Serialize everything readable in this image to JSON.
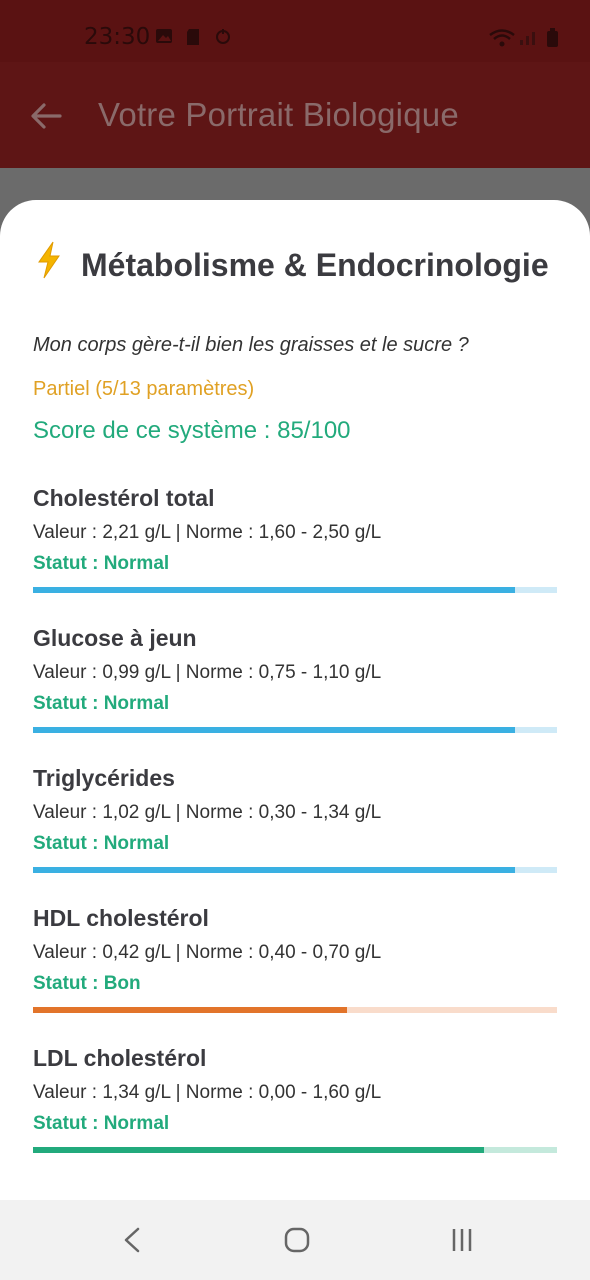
{
  "status_bar": {
    "time": "23:30"
  },
  "app_bar": {
    "title": "Votre Portrait Biologique"
  },
  "section": {
    "title": "Métabolisme & Endocrinologie",
    "question": "Mon corps gère-t-il bien les graisses et le sucre ?",
    "partial": "Partiel (5/13 paramètres)",
    "score": "Score de ce système : 85/100"
  },
  "params": [
    {
      "name": "Cholestérol total",
      "value": "Valeur : 2,21 g/L | Norme : 1,60 - 2,50 g/L",
      "status": "Statut : Normal",
      "fill": 0.92,
      "color": "#3ab0e2",
      "track": "#cfeaf7"
    },
    {
      "name": "Glucose à jeun",
      "value": "Valeur : 0,99 g/L | Norme : 0,75 - 1,10 g/L",
      "status": "Statut : Normal",
      "fill": 0.92,
      "color": "#3ab0e2",
      "track": "#cfeaf7"
    },
    {
      "name": "Triglycérides",
      "value": "Valeur : 1,02 g/L | Norme : 0,30 - 1,34 g/L",
      "status": "Statut : Normal",
      "fill": 0.92,
      "color": "#3ab0e2",
      "track": "#cfeaf7"
    },
    {
      "name": "HDL cholestérol",
      "value": "Valeur : 0,42 g/L | Norme : 0,40 - 0,70 g/L",
      "status": "Statut : Bon",
      "fill": 0.6,
      "color": "#e2742a",
      "track": "#f9dccb"
    },
    {
      "name": "LDL cholestérol",
      "value": "Valeur : 1,34 g/L | Norme : 0,00 - 1,60 g/L",
      "status": "Statut : Normal",
      "fill": 0.86,
      "color": "#22aa7c",
      "track": "#c4e9dc"
    }
  ]
}
